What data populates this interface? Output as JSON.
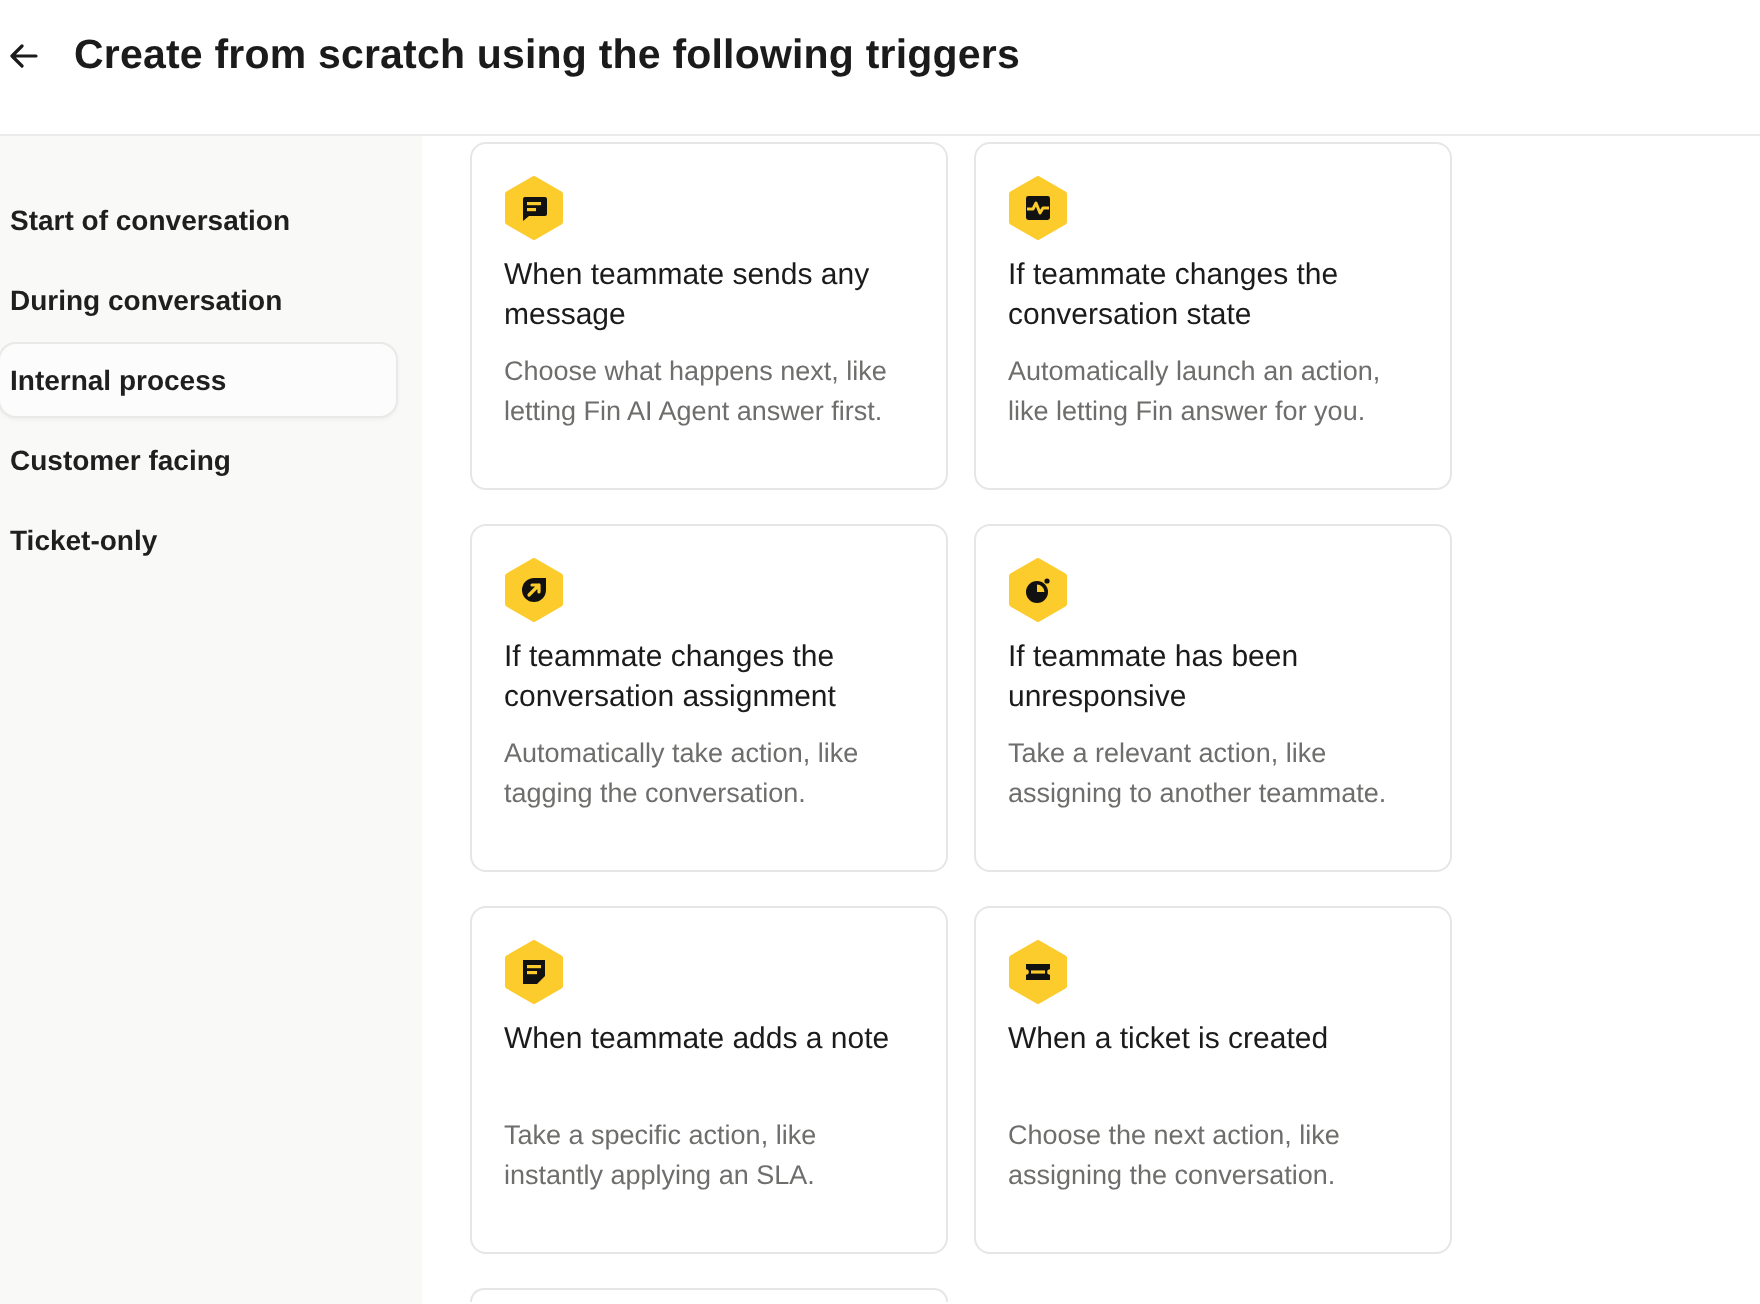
{
  "header": {
    "title": "Create from scratch using the following triggers"
  },
  "sidebar": {
    "items": [
      {
        "label": "Start of conversation",
        "selected": false
      },
      {
        "label": "During conversation",
        "selected": false
      },
      {
        "label": "Internal process",
        "selected": true
      },
      {
        "label": "Customer facing",
        "selected": false
      },
      {
        "label": "Ticket-only",
        "selected": false
      }
    ]
  },
  "cards": [
    {
      "title": "When teammate sends any message",
      "description": "Choose what happens next, like letting Fin AI Agent answer first."
    },
    {
      "title": "If teammate changes the conversation state",
      "description": "Automatically launch an action, like letting Fin answer for you."
    },
    {
      "title": "If teammate changes the conversation assignment",
      "description": "Automatically take action, like tagging the conversation."
    },
    {
      "title": "If teammate has been unresponsive",
      "description": "Take a relevant action, like assigning to another teammate."
    },
    {
      "title": "When teammate adds a note",
      "description": "Take a specific action, like instantly applying an SLA."
    },
    {
      "title": "When a ticket is created",
      "description": "Choose the next action, like assigning the conversation."
    }
  ],
  "more_cards_below": true
}
